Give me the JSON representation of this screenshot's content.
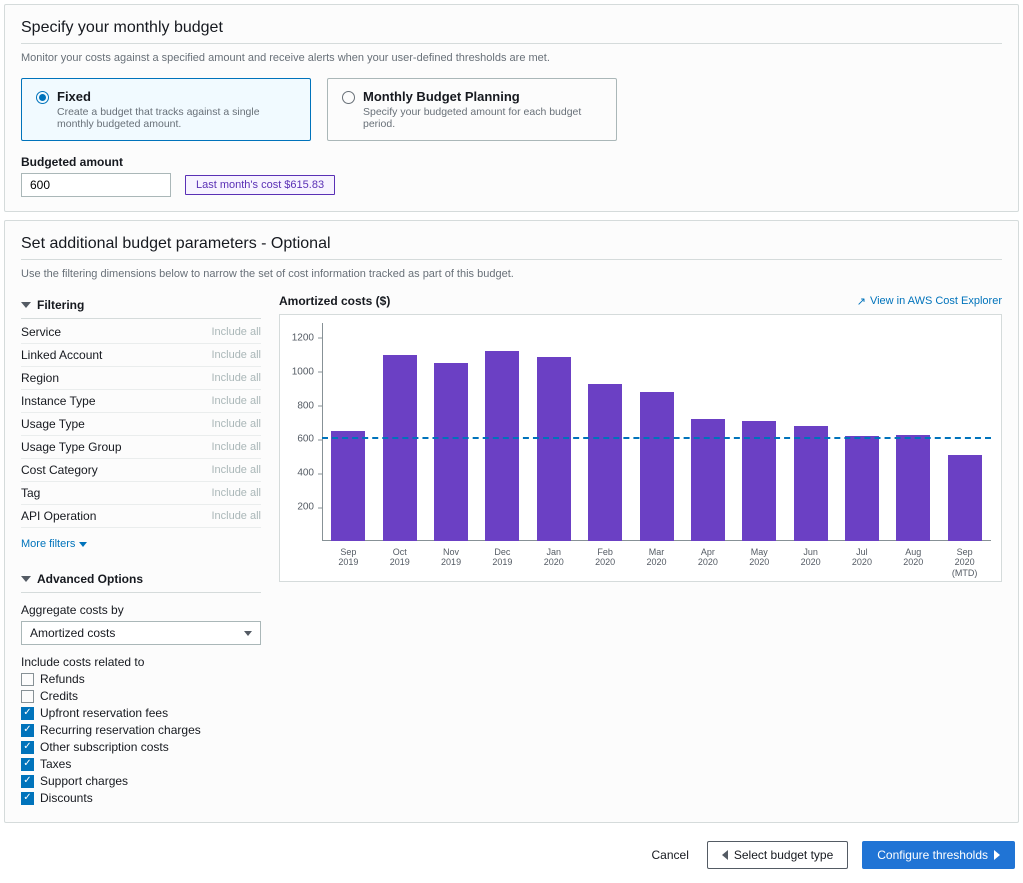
{
  "panel1": {
    "title": "Specify your monthly budget",
    "desc": "Monitor your costs against a specified amount and receive alerts when your user-defined thresholds are met.",
    "option_fixed": {
      "title": "Fixed",
      "sub": "Create a budget that tracks against a single monthly budgeted amount."
    },
    "option_plan": {
      "title": "Monthly Budget Planning",
      "sub": "Specify your budgeted amount for each budget period."
    },
    "amount_label": "Budgeted amount",
    "amount_value": "600",
    "last_month_chip": "Last month's cost $615.83"
  },
  "panel2": {
    "title": "Set additional budget parameters - Optional",
    "desc": "Use the filtering dimensions below to narrow the set of cost information tracked as part of this budget.",
    "filtering_label": "Filtering",
    "filter_hint": "Include all",
    "filters": [
      "Service",
      "Linked Account",
      "Region",
      "Instance Type",
      "Usage Type",
      "Usage Type Group",
      "Cost Category",
      "Tag",
      "API Operation"
    ],
    "more_filters": "More filters",
    "advanced_label": "Advanced Options",
    "aggregate_label": "Aggregate costs by",
    "aggregate_value": "Amortized costs",
    "include_label": "Include costs related to",
    "include_items": [
      {
        "label": "Refunds",
        "checked": false
      },
      {
        "label": "Credits",
        "checked": false
      },
      {
        "label": "Upfront reservation fees",
        "checked": true
      },
      {
        "label": "Recurring reservation charges",
        "checked": true
      },
      {
        "label": "Other subscription costs",
        "checked": true
      },
      {
        "label": "Taxes",
        "checked": true
      },
      {
        "label": "Support charges",
        "checked": true
      },
      {
        "label": "Discounts",
        "checked": true
      }
    ],
    "chart_title": "Amortized costs ($)",
    "view_link": "View in AWS Cost Explorer"
  },
  "chart_data": {
    "type": "bar",
    "title": "Amortized costs ($)",
    "xlabel": "",
    "ylabel": "",
    "ylim": [
      0,
      1300
    ],
    "yticks": [
      200,
      400,
      600,
      800,
      1000,
      1200
    ],
    "threshold": 600,
    "categories": [
      "Sep 2019",
      "Oct 2019",
      "Nov 2019",
      "Dec 2019",
      "Jan 2020",
      "Feb 2020",
      "Mar 2020",
      "Apr 2020",
      "May 2020",
      "Jun 2020",
      "Jul 2020",
      "Aug 2020",
      "Sep 2020 (MTD)"
    ],
    "values": [
      650,
      1100,
      1050,
      1120,
      1090,
      930,
      880,
      720,
      710,
      680,
      620,
      625,
      510
    ]
  },
  "footer": {
    "cancel": "Cancel",
    "back": "Select budget type",
    "next": "Configure thresholds"
  }
}
